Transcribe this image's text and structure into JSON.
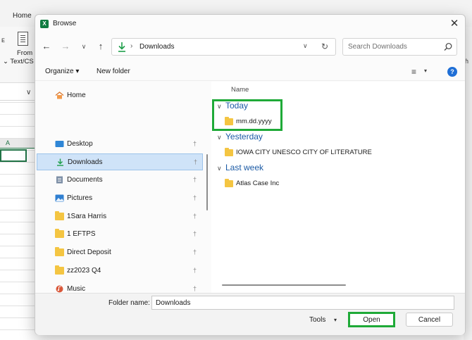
{
  "excel": {
    "home_tab": "Home",
    "from_label": "From",
    "text_label": "⌄ Text/CS",
    "column_a": "A",
    "left_stub": "ᴇ",
    "right_stub": "ɦ"
  },
  "dialog": {
    "title": "Browse",
    "close": "✕",
    "nav": {
      "back": "←",
      "forward": "→",
      "recent": "∨",
      "up": "↑"
    },
    "address": {
      "separator": "›",
      "path": "Downloads",
      "dropdown": "∨",
      "refresh": "↻"
    },
    "search": {
      "placeholder": "Search Downloads"
    },
    "commands": {
      "organize": "Organize ▾",
      "new_folder": "New folder",
      "view": "≡",
      "view_chevron": "▾",
      "help": "?"
    },
    "nav_pane": {
      "items": [
        {
          "label": "Home",
          "icon": "home-icon",
          "pinned": false
        },
        {
          "label": "Desktop",
          "icon": "desktop-icon",
          "pinned": true
        },
        {
          "label": "Downloads",
          "icon": "download-icon",
          "pinned": true,
          "selected": true
        },
        {
          "label": "Documents",
          "icon": "documents-icon",
          "pinned": true
        },
        {
          "label": "Pictures",
          "icon": "pictures-icon",
          "pinned": true
        },
        {
          "label": "1Sara Harris",
          "icon": "folder-icon",
          "pinned": true
        },
        {
          "label": "1 EFTPS",
          "icon": "folder-icon",
          "pinned": true
        },
        {
          "label": "Direct Deposit",
          "icon": "folder-icon",
          "pinned": true
        },
        {
          "label": "zz2023 Q4",
          "icon": "folder-icon",
          "pinned": true
        },
        {
          "label": "Music",
          "icon": "music-icon",
          "pinned": true
        }
      ],
      "pin_glyph": "†"
    },
    "content": {
      "column_header": "Name",
      "groups": [
        {
          "label": "Today",
          "files": [
            "mm.dd.yyyy"
          ]
        },
        {
          "label": "Yesterday",
          "files": [
            "IOWA CITY UNESCO CITY OF LITERATURE"
          ]
        },
        {
          "label": "Last week",
          "files": [
            "Atlas Case Inc"
          ]
        }
      ],
      "chevron": "∨"
    },
    "footer": {
      "folder_name_label": "Folder name:",
      "folder_name_value": "Downloads",
      "tools": "Tools",
      "tools_chevron": "▾",
      "open": "Open",
      "cancel": "Cancel"
    },
    "colors": {
      "highlight": "#1faa38",
      "accent": "#1b5aa5",
      "selection": "#cfe3f8",
      "folder": "#f4c542"
    }
  }
}
